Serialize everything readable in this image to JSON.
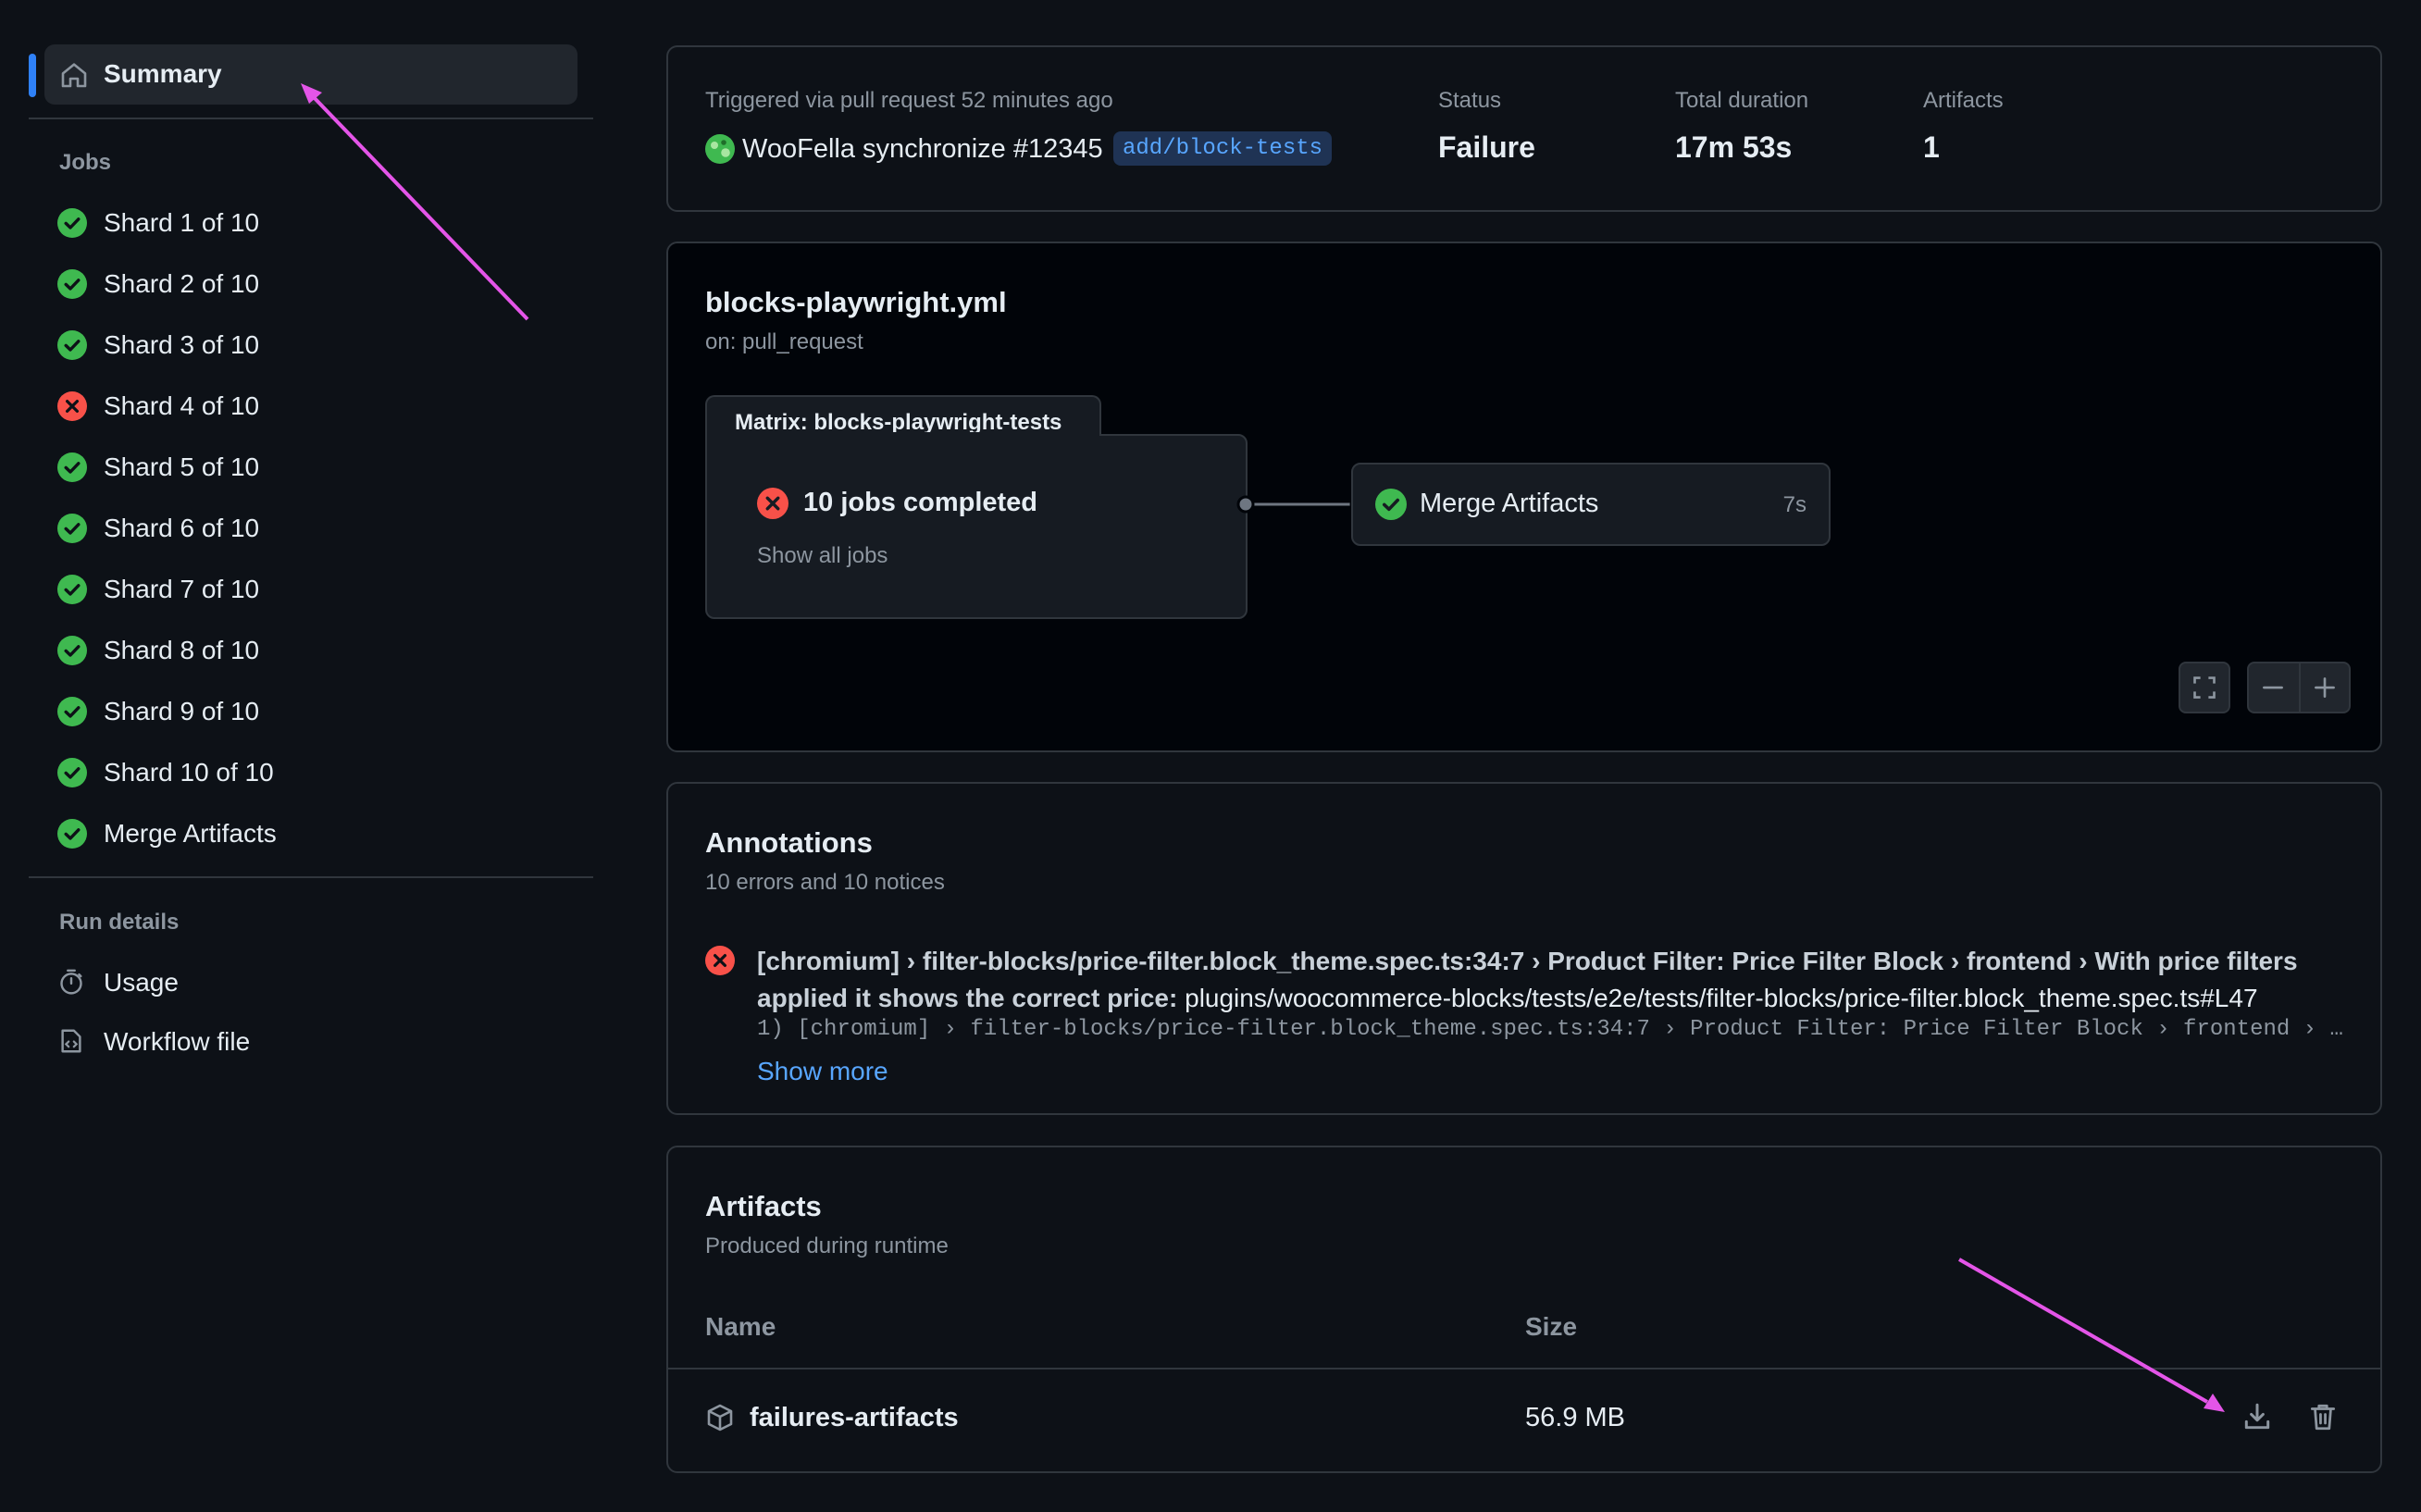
{
  "sidebar": {
    "summary_label": "Summary",
    "jobs_title": "Jobs",
    "jobs": [
      {
        "label": "Shard 1 of 10",
        "status": "success"
      },
      {
        "label": "Shard 2 of 10",
        "status": "success"
      },
      {
        "label": "Shard 3 of 10",
        "status": "success"
      },
      {
        "label": "Shard 4 of 10",
        "status": "failure"
      },
      {
        "label": "Shard 5 of 10",
        "status": "success"
      },
      {
        "label": "Shard 6 of 10",
        "status": "success"
      },
      {
        "label": "Shard 7 of 10",
        "status": "success"
      },
      {
        "label": "Shard 8 of 10",
        "status": "success"
      },
      {
        "label": "Shard 9 of 10",
        "status": "success"
      },
      {
        "label": "Shard 10 of 10",
        "status": "success"
      },
      {
        "label": "Merge Artifacts",
        "status": "success"
      }
    ],
    "run_details_title": "Run details",
    "usage_label": "Usage",
    "workflow_file_label": "Workflow file"
  },
  "summary": {
    "trigger_caption": "Triggered via pull request 52 minutes ago",
    "trigger_text": "WooFella synchronize #12345",
    "branch": "add/block-tests",
    "status_caption": "Status",
    "status_value": "Failure",
    "duration_caption": "Total duration",
    "duration_value": "17m 53s",
    "artifacts_caption": "Artifacts",
    "artifacts_value": "1"
  },
  "workflow": {
    "file": "blocks-playwright.yml",
    "trigger": "on: pull_request",
    "matrix_label": "Matrix: blocks-playwright-tests",
    "matrix_status": "10 jobs completed",
    "show_all_jobs": "Show all jobs",
    "merge_job": "Merge Artifacts",
    "merge_duration": "7s"
  },
  "annotations": {
    "title": "Annotations",
    "subtitle": "10 errors and 10 notices",
    "items": [
      {
        "title": "[chromium] › filter-blocks/price-filter.block_theme.spec.ts:34:7 › Product Filter: Price Filter Block › frontend › With price filters applied it shows the correct price:",
        "path": " plugins/woocommerce-blocks/tests/e2e/tests/filter-blocks/price-filter.block_theme.spec.ts#L47",
        "detail": "1) [chromium] › filter-blocks/price-filter.block_theme.spec.ts:34:7 › Product Filter: Price Filter Block › frontend › …",
        "show_more": "Show more"
      }
    ]
  },
  "artifacts": {
    "title": "Artifacts",
    "subtitle": "Produced during runtime",
    "col_name": "Name",
    "col_size": "Size",
    "rows": [
      {
        "name": "failures-artifacts",
        "size": "56.9 MB"
      }
    ]
  },
  "colors": {
    "accent": "#2f81f7",
    "success": "#3fb950",
    "failure": "#f85149",
    "annotation_arrow": "#e455e8"
  }
}
